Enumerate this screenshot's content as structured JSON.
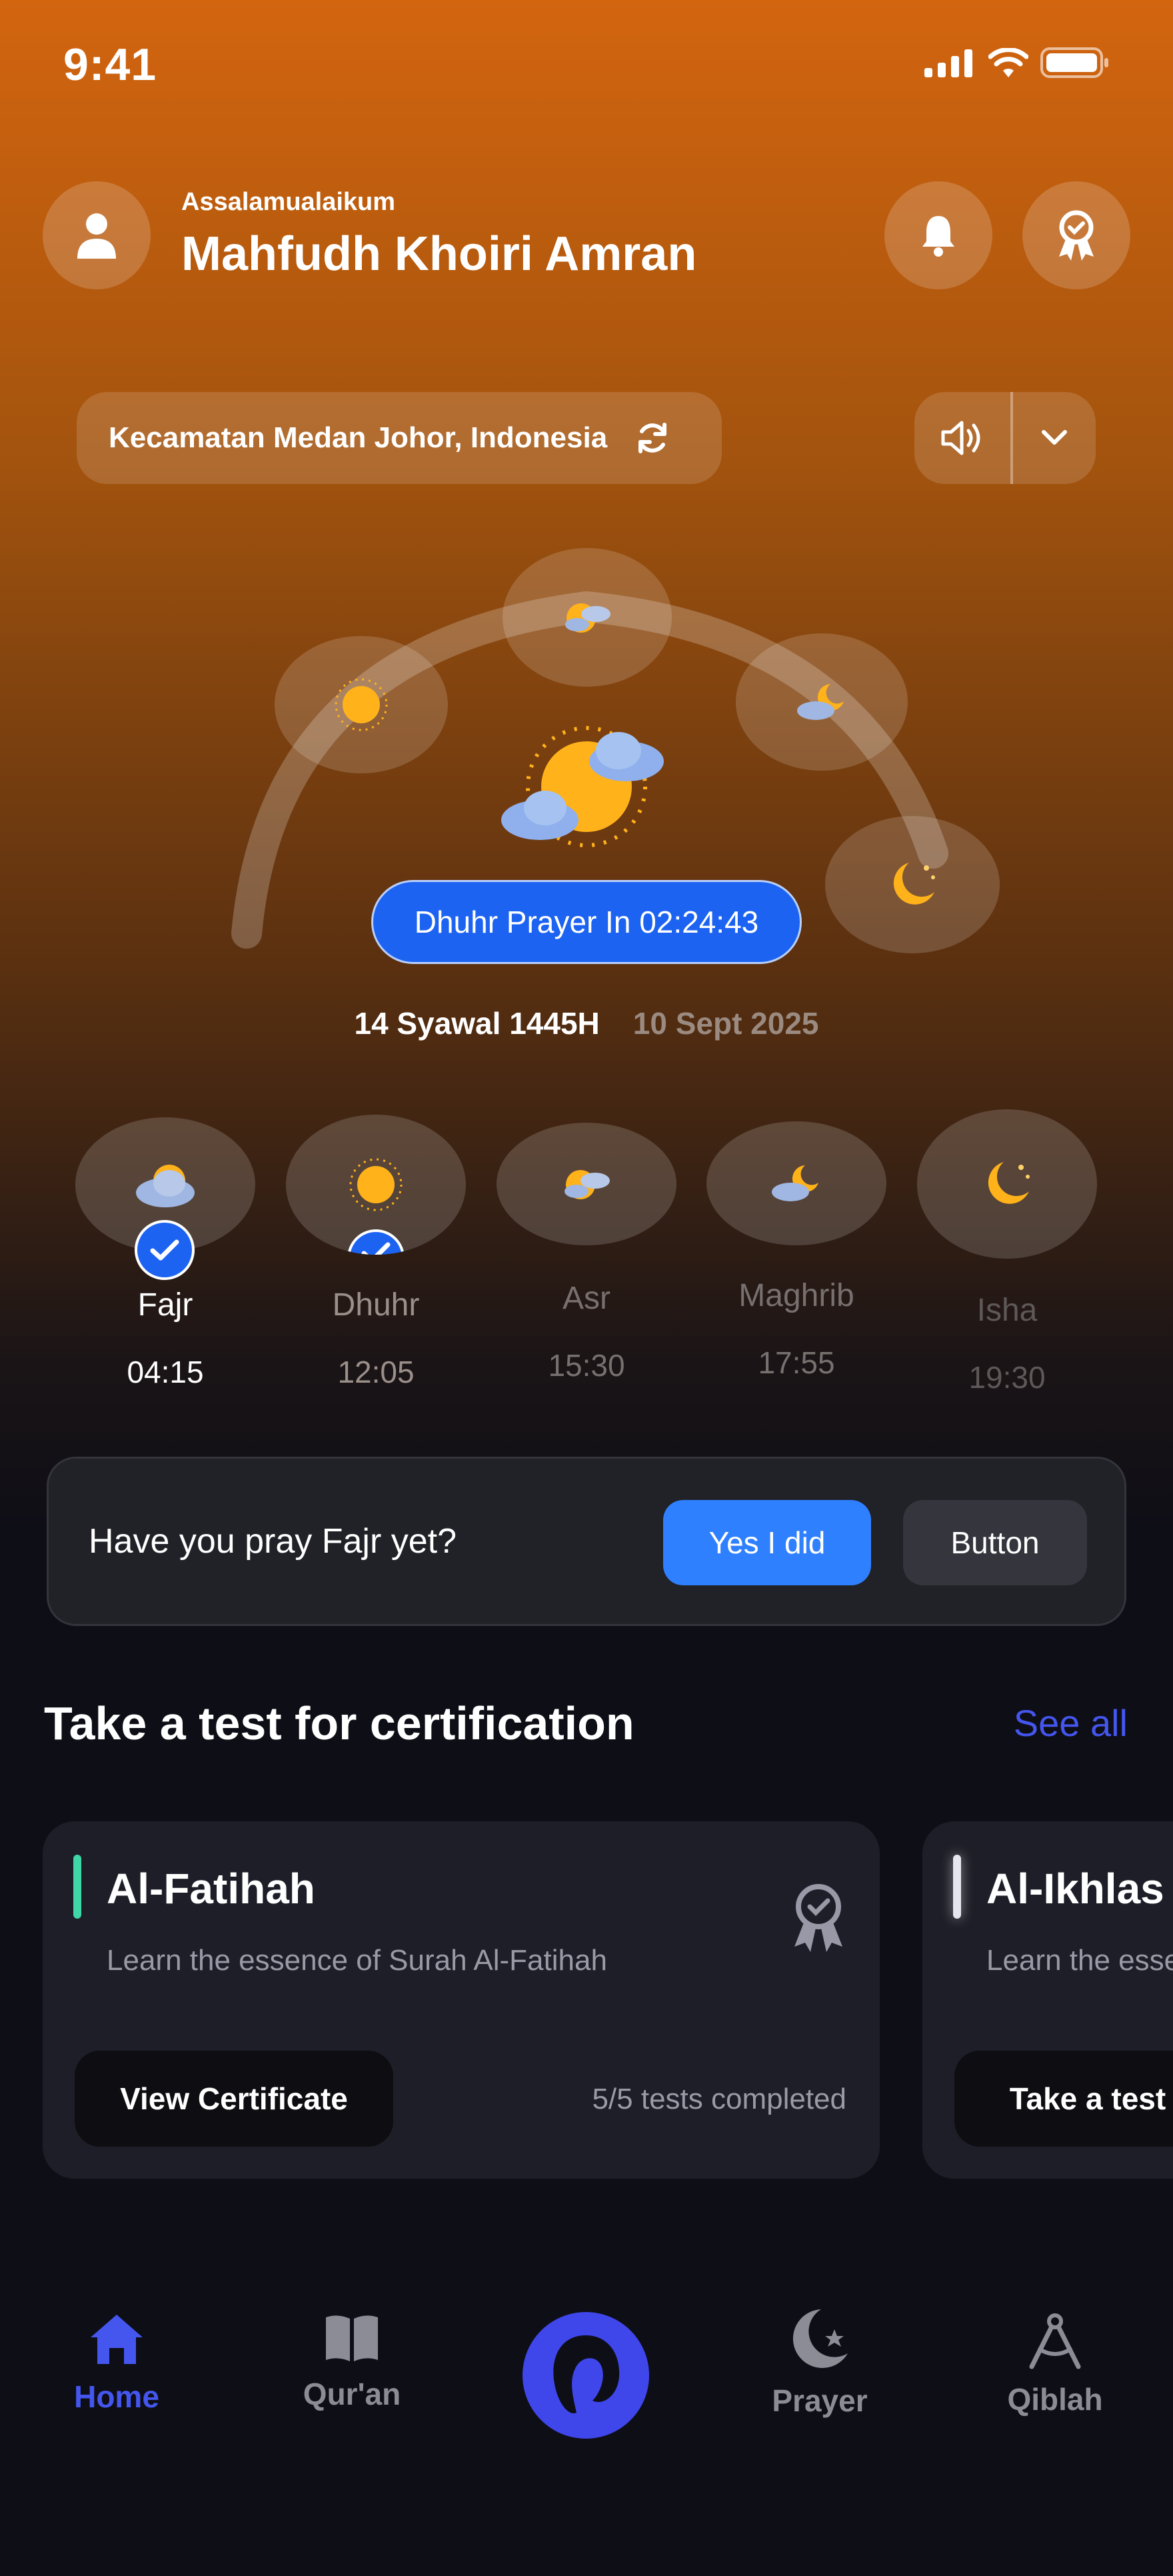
{
  "status": {
    "time": "9:41"
  },
  "header": {
    "greeting": "Assalamualaikum",
    "name": "Mahfudh Khoiri Amran"
  },
  "location": {
    "text": "Kecamatan Medan Johor, Indonesia"
  },
  "next_prayer": {
    "label": "Dhuhr Prayer In 02:24:43"
  },
  "dates": {
    "hijri": "14 Syawal 1445H",
    "gregorian": "10 Sept 2025"
  },
  "prayers": [
    {
      "name": "Fajr",
      "time": "04:15",
      "done": true,
      "icon": "cloud-sun-icon"
    },
    {
      "name": "Dhuhr",
      "time": "12:05",
      "done": true,
      "icon": "sun-icon"
    },
    {
      "name": "Asr",
      "time": "15:30",
      "done": false,
      "icon": "sun-cloud-icon"
    },
    {
      "name": "Maghrib",
      "time": "17:55",
      "done": false,
      "icon": "moon-cloud-icon"
    },
    {
      "name": "Isha",
      "time": "19:30",
      "done": false,
      "icon": "moon-stars-icon"
    }
  ],
  "confirm": {
    "question": "Have you pray Fajr yet?",
    "yes_label": "Yes I did",
    "other_label": "Button"
  },
  "certification": {
    "title": "Take a test for certification",
    "see_all": "See all",
    "cards": [
      {
        "title": "Al-Fatihah",
        "desc": "Learn the essence of Surah Al-Fatihah",
        "button": "View Certificate",
        "progress": "5/5 tests completed",
        "accent": "#3fd6a8"
      },
      {
        "title": "Al-Ikhlas",
        "desc": "Learn the essence of Surah Al-Ikhlas",
        "button": "Take a test",
        "accent": "#e6e6ee"
      }
    ]
  },
  "nav": [
    {
      "label": "Home",
      "active": true
    },
    {
      "label": "Qur'an"
    },
    {
      "label": "Prayer"
    },
    {
      "label": "Qiblah"
    }
  ],
  "colors": {
    "accent_blue": "#1d63f2",
    "nav_active": "#4456ee",
    "sun": "#ffb21a"
  }
}
